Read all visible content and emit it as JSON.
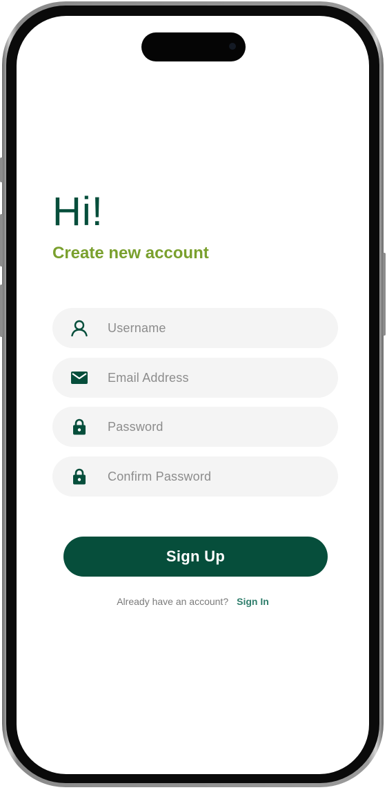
{
  "header": {
    "greeting": "Hi!",
    "subtitle": "Create new account"
  },
  "form": {
    "fields": [
      {
        "placeholder": "Username",
        "icon": "user-icon"
      },
      {
        "placeholder": "Email Address",
        "icon": "mail-icon"
      },
      {
        "placeholder": "Password",
        "icon": "lock-icon"
      },
      {
        "placeholder": "Confirm Password",
        "icon": "lock-icon"
      }
    ],
    "submit_label": "Sign Up"
  },
  "footer": {
    "prompt": "Already have an account?",
    "link_label": "Sign In"
  },
  "colors": {
    "primary": "#064e3b",
    "accent": "#7aa02e",
    "field_bg": "#f4f4f4",
    "link": "#2e7d6b"
  }
}
